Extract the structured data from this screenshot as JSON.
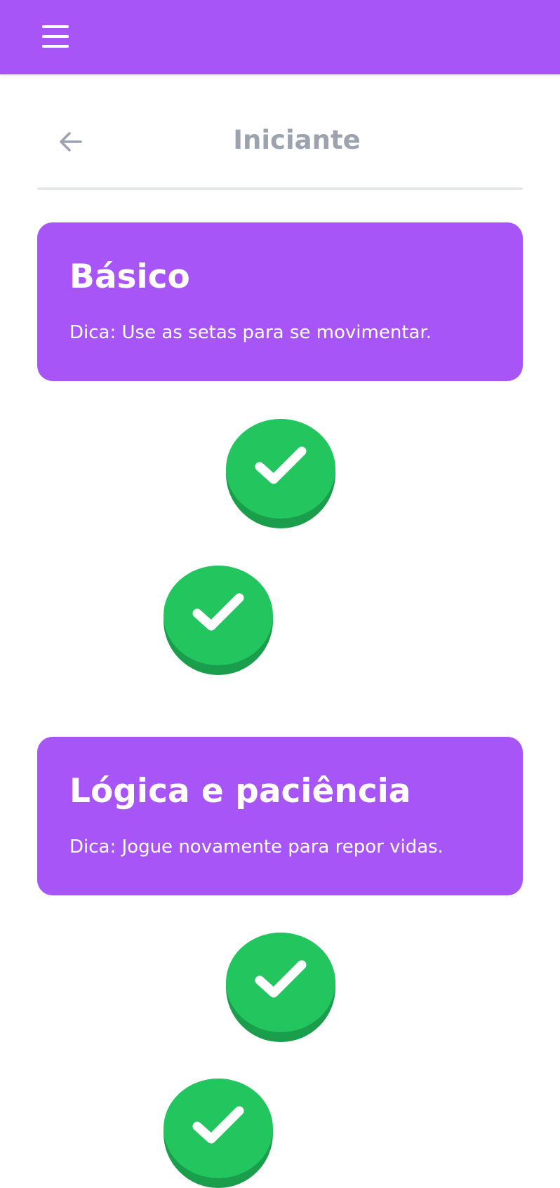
{
  "header": {
    "menu_icon": "hamburger-menu-icon",
    "back_icon": "arrow-left-icon",
    "title": "Iniciante"
  },
  "colors": {
    "brand": "#a855f7",
    "lesson_complete": "#22c55e",
    "lesson_complete_shadow": "#1a9e4b",
    "title_gray": "#9ca3af",
    "divider": "#e5e7eb"
  },
  "sections": [
    {
      "title": "Básico",
      "tip": "Dica: Use as setas para se movimentar.",
      "lessons": [
        {
          "status": "completed",
          "icon": "checkmark-icon"
        },
        {
          "status": "completed",
          "icon": "checkmark-icon"
        }
      ]
    },
    {
      "title": "Lógica e paciência",
      "tip": "Dica: Jogue novamente para repor vidas.",
      "lessons": [
        {
          "status": "completed",
          "icon": "checkmark-icon"
        },
        {
          "status": "completed",
          "icon": "checkmark-icon"
        }
      ]
    }
  ]
}
